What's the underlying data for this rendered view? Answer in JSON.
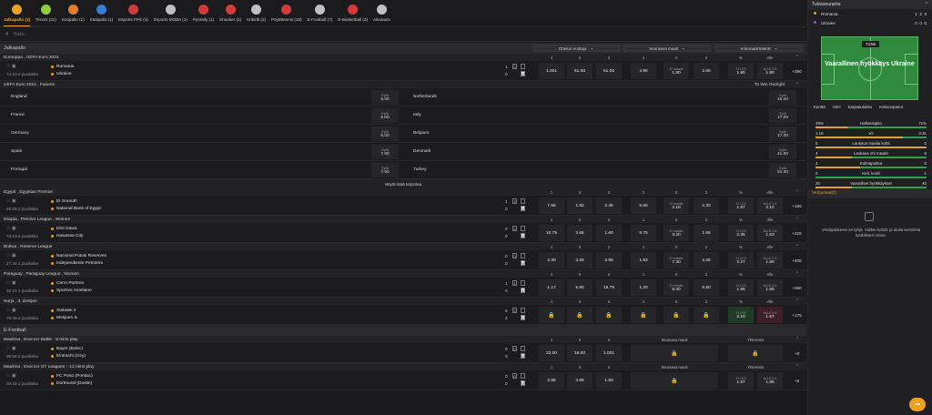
{
  "sports": [
    {
      "label": "Jalkapallo (1)",
      "icon": "soccer-icon",
      "color": "#f0a020",
      "active": true
    },
    {
      "label": "Tennis (31)",
      "icon": "tennis-icon",
      "color": "#8fcf3a"
    },
    {
      "label": "Koripallo (1)",
      "icon": "basketball-icon",
      "color": "#e67b2a"
    },
    {
      "label": "Käsipallo (1)",
      "icon": "handball-icon",
      "color": "#3a7bd5"
    },
    {
      "label": "Esports FPS (3)",
      "icon": "fps-icon",
      "color": "#d43a3a"
    },
    {
      "label": "Esports MOBA (1)",
      "icon": "moba-icon",
      "color": "#c0c0c0"
    },
    {
      "label": "Pyöräily (1)",
      "icon": "cycling-icon",
      "color": "#d43a3a"
    },
    {
      "label": "Snooker (2)",
      "icon": "snooker-icon",
      "color": "#d43a3a"
    },
    {
      "label": "Kriketti (2)",
      "icon": "cricket-icon",
      "color": "#c0c0c0"
    },
    {
      "label": "Pöytätennis (18)",
      "icon": "table-tennis-icon",
      "color": "#d43a3a"
    },
    {
      "label": "E-Football (7)",
      "icon": "efootball-icon",
      "color": "#c0c0c0"
    },
    {
      "label": "E-Basketball (3)",
      "icon": "ebasketball-icon",
      "color": "#d43a3a"
    },
    {
      "label": "Aikataulu",
      "icon": "calendar-icon",
      "color": "#c0c0c0"
    }
  ],
  "search": {
    "placeholder": "Haku"
  },
  "section_football": {
    "title": "Jalkapallo",
    "dd1": "Ottelun voittaja",
    "dd2": "Seuraava maali",
    "dd3": "Kokonaismäärät"
  },
  "hdr": {
    "one": "1",
    "x": "X",
    "two": "2",
    "yli": "Yli",
    "alle": "Alle",
    "pct": "%"
  },
  "euro": {
    "league": "Eurooppa , UEFA Euro 2024",
    "time": "74:10-2 puoliaika",
    "home": "Romania",
    "away": "Ukraine",
    "hs": "1",
    "as": "0",
    "hs2": "2",
    "as2": "0",
    "o1": "1.001",
    "ox": "51.00",
    "o2": "51.00",
    "n1": "4.90",
    "nx_top": "Ei maalia",
    "nx": "1.90",
    "n2": "2.65",
    "yli_top": "YLI 3.5",
    "yli": "1.90",
    "alle_top": "ALLE 3.5",
    "alle": "1.90",
    "more": "+380"
  },
  "futures": {
    "league": "UEFA Euro 2024 , Futures",
    "to_win": "To Win Outright",
    "kylla": "Kyllä",
    "rows": [
      {
        "l": "England",
        "lo": "5.00",
        "r": "Netherlands",
        "ro": "15.00"
      },
      {
        "l": "France",
        "lo": "5.00",
        "r": "Italy",
        "ro": "17.00"
      },
      {
        "l": "Germany",
        "lo": "6.00",
        "r": "Belgium",
        "ro": "17.00"
      },
      {
        "l": "Spain",
        "lo": "7.00",
        "r": "Denmark",
        "ro": "41.00"
      },
      {
        "l": "Portugal",
        "lo": "7.50",
        "r": "Turkey",
        "ro": "51.00"
      }
    ],
    "show_more": "Näytä lisää tarjontaa"
  },
  "matches": [
    {
      "league": "Egypti , Egyptian Premier",
      "time": "58:06-2 puoliaika",
      "home": "El Gounah",
      "away": "National Bank of Egypt",
      "hs": "1",
      "as": "0",
      "hs2": "3",
      "as2": "1",
      "o1": "7.55",
      "ox": "1.82",
      "o2": "2.45",
      "n1": "5.65",
      "nx_top": "Ei maalia",
      "nx": "2.10",
      "n2": "2.30",
      "yli_top": "YLI 2.5",
      "yli": "1.67",
      "alle_top": "ALLE 2.5",
      "alle": "2.10",
      "more": "+186"
    },
    {
      "league": "Etiopia , Premier League , Women",
      "time": "73:10-2 puoliaika",
      "home": "Dire Dawa",
      "away": "Hawassa City",
      "hs": "0",
      "as": "0",
      "hs2": "2",
      "as2": "2",
      "o1": "10.75",
      "ox": "2.65",
      "o2": "1.60",
      "n1": "6.75",
      "nx_top": "Ei maalia",
      "nx": "3.20",
      "n2": "1.55",
      "yli_top": "YLI 0.5",
      "yli": "2.35",
      "alle_top": "ALLE 0.5",
      "alle": "1.53",
      "more": "+225"
    },
    {
      "league": "Bolivia , Reserve League",
      "time": "27:44-1 puoliaika",
      "home": "Nacional Potosi Reserves",
      "away": "Independiente Petrolero",
      "hs": "0",
      "as": "0",
      "hs2": "0",
      "as2": "0",
      "o1": "2.30",
      "ox": "3.25",
      "o2": "2.85",
      "n1": "1.93",
      "nx_top": "Ei maalia",
      "nx": "7.30",
      "n2": "2.25",
      "yli_top": "YLI 2.5",
      "yli": "2.27",
      "alle_top": "ALLE 2.5",
      "alle": "1.60",
      "more": "+406"
    },
    {
      "league": "Paraguay , Paraguay League , Women",
      "time": "32:21-1 puoliaika",
      "home": "Cerro Porteno",
      "away": "Sportivo Ameliano",
      "hs": "1",
      "as": "0",
      "hs2": "1",
      "as2": "1",
      "o1": "1.17",
      "ox": "5.90",
      "o2": "16.75",
      "n1": "1.20",
      "nx_top": "Ei maalia",
      "nx": "8.40",
      "n2": "6.60",
      "yli_top": "YLI 4.5",
      "yli": "1.85",
      "alle_top": "ALLE 4.5",
      "alle": "1.85",
      "more": "+360"
    },
    {
      "league": "Norja , 3. divisjon",
      "time": "76:35-2 puoliaika",
      "home": "Stabaek 2",
      "away": "Mosjoen IL",
      "hs": "6",
      "as": "2",
      "hs2": "2",
      "as2": "1",
      "locked": true,
      "yli_top": "YLI 9.5",
      "yli": "2.10",
      "alle_top": "ALLE 9.5",
      "alle": "1.67",
      "more": "+175"
    }
  ],
  "section_efootball": {
    "title": "E-Football"
  },
  "ematches": [
    {
      "league": "Maailma , Esoccer Battle - 8 mins play",
      "time": "06:58-2 puoliaika",
      "home": "Bayer (Bolec)",
      "away": "Eintracht (Izzy)",
      "hs": "0",
      "as": "0",
      "hs2": "0",
      "as2": "0",
      "o1": "22.00",
      "ox": "18.00",
      "o2": "1.001",
      "more": "+9"
    },
    {
      "league": "Maailma , Esoccer GT Leagues – 12 mins play",
      "time": "02:15-1 puoliaika",
      "home": "FC Porto (Pontiac)",
      "away": "Dortmund (Dustin)",
      "hs": "0",
      "as": "0",
      "hs2": "0",
      "as2": "0",
      "o1": "3.85",
      "ox": "4.85",
      "o2": "1.50",
      "yli_top": "YLI 6.5",
      "yli": "1.67",
      "alle_top": "ALLE 6.5",
      "alle": "1.85",
      "more": "+8"
    }
  ],
  "ehdr": {
    "next": "Seuraava maali",
    "total": "Yhteensä"
  },
  "side": {
    "title": "Tulosseuranta",
    "home": "Romania",
    "away": "Ukraine",
    "home_scores": [
      "1",
      "2",
      "3"
    ],
    "away_scores": [
      "0",
      "0",
      "0"
    ],
    "clock": "74:56",
    "message": "Vaarallinen hyökkäys Ukraine",
    "tabs": [
      "Kenttä",
      "H2H",
      "Sarjataulukko",
      "Kokoonpanot"
    ],
    "stats": [
      {
        "l": "29%",
        "c": "Hallussapito",
        "r": "71%",
        "pl": 29
      },
      {
        "l": "1.16",
        "c": "xG",
        "r": "0.31",
        "pl": 79
      },
      {
        "l": "5",
        "c": "Laukaus maalia kohti",
        "r": "0",
        "pl": 100
      },
      {
        "l": "4",
        "c": "Laukaus ohi maalin",
        "r": "8",
        "pl": 33
      },
      {
        "l": "4",
        "c": "Kulmapotkut",
        "r": "6",
        "pl": 40
      },
      {
        "l": "0",
        "c": "Kelt. kortit",
        "r": "1",
        "pl": 0
      },
      {
        "l": "20",
        "c": "Vaaralliset hyökkäykset",
        "r": "40",
        "pl": 33
      }
    ],
    "slip_title": "Vetoyosat(0)",
    "slip_empty": "Vetolipukkeesi on tyhjä. Valitse kohde ja aloita kertoimia lyödöksesi vetoa."
  },
  "colors": {
    "accent": "#f0a020",
    "green": "#2fa04a"
  }
}
